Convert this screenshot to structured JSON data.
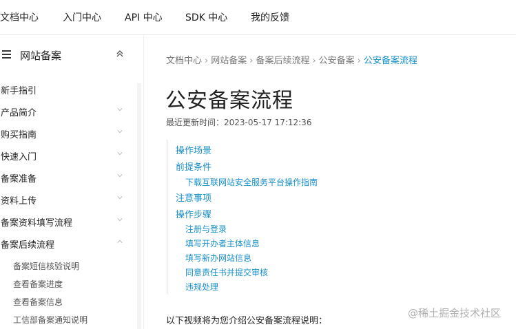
{
  "topnav": {
    "items": [
      "文档中心",
      "入门中心",
      "API 中心",
      "SDK 中心",
      "我的反馈"
    ]
  },
  "sidebar": {
    "title": "网站备案",
    "items": [
      {
        "label": "新手指引",
        "chevron": "none"
      },
      {
        "label": "产品简介",
        "chevron": "down"
      },
      {
        "label": "购买指南",
        "chevron": "down"
      },
      {
        "label": "快速入门",
        "chevron": "down"
      },
      {
        "label": "备案准备",
        "chevron": "down"
      },
      {
        "label": "资料上传",
        "chevron": "down"
      },
      {
        "label": "备案资料填写流程",
        "chevron": "down"
      },
      {
        "label": "备案后续流程",
        "chevron": "up"
      }
    ],
    "subitems": [
      "备案短信核验说明",
      "查看备案进度",
      "查看备案信息",
      "工信部备案通知说明"
    ]
  },
  "breadcrumb": {
    "items": [
      "文档中心",
      "网站备案",
      "备案后续流程",
      "公安备案",
      "公安备案流程"
    ],
    "separator": "›"
  },
  "page": {
    "title": "公安备案流程",
    "updated": "最近更新时间：2023-05-17 17:12:36",
    "intro": "以下视频将为您介绍公安备案流程说明："
  },
  "toc": {
    "items": [
      {
        "label": "操作场景",
        "level": 1
      },
      {
        "label": "前提条件",
        "level": 1
      },
      {
        "label": "下载互联网站安全服务平台操作指南",
        "level": 2
      },
      {
        "label": "注意事项",
        "level": 1
      },
      {
        "label": "操作步骤",
        "level": 1
      },
      {
        "label": "注册与登录",
        "level": 2
      },
      {
        "label": "填写开办者主体信息",
        "level": 2
      },
      {
        "label": "填写新办网站信息",
        "level": 2
      },
      {
        "label": "同意责任书并提交审核",
        "level": 2
      },
      {
        "label": "违规处理",
        "level": 2
      }
    ]
  },
  "watermark": "@稀土掘金技术社区",
  "colors": {
    "link": "#1890c8",
    "text": "#222222",
    "muted": "#777777"
  }
}
